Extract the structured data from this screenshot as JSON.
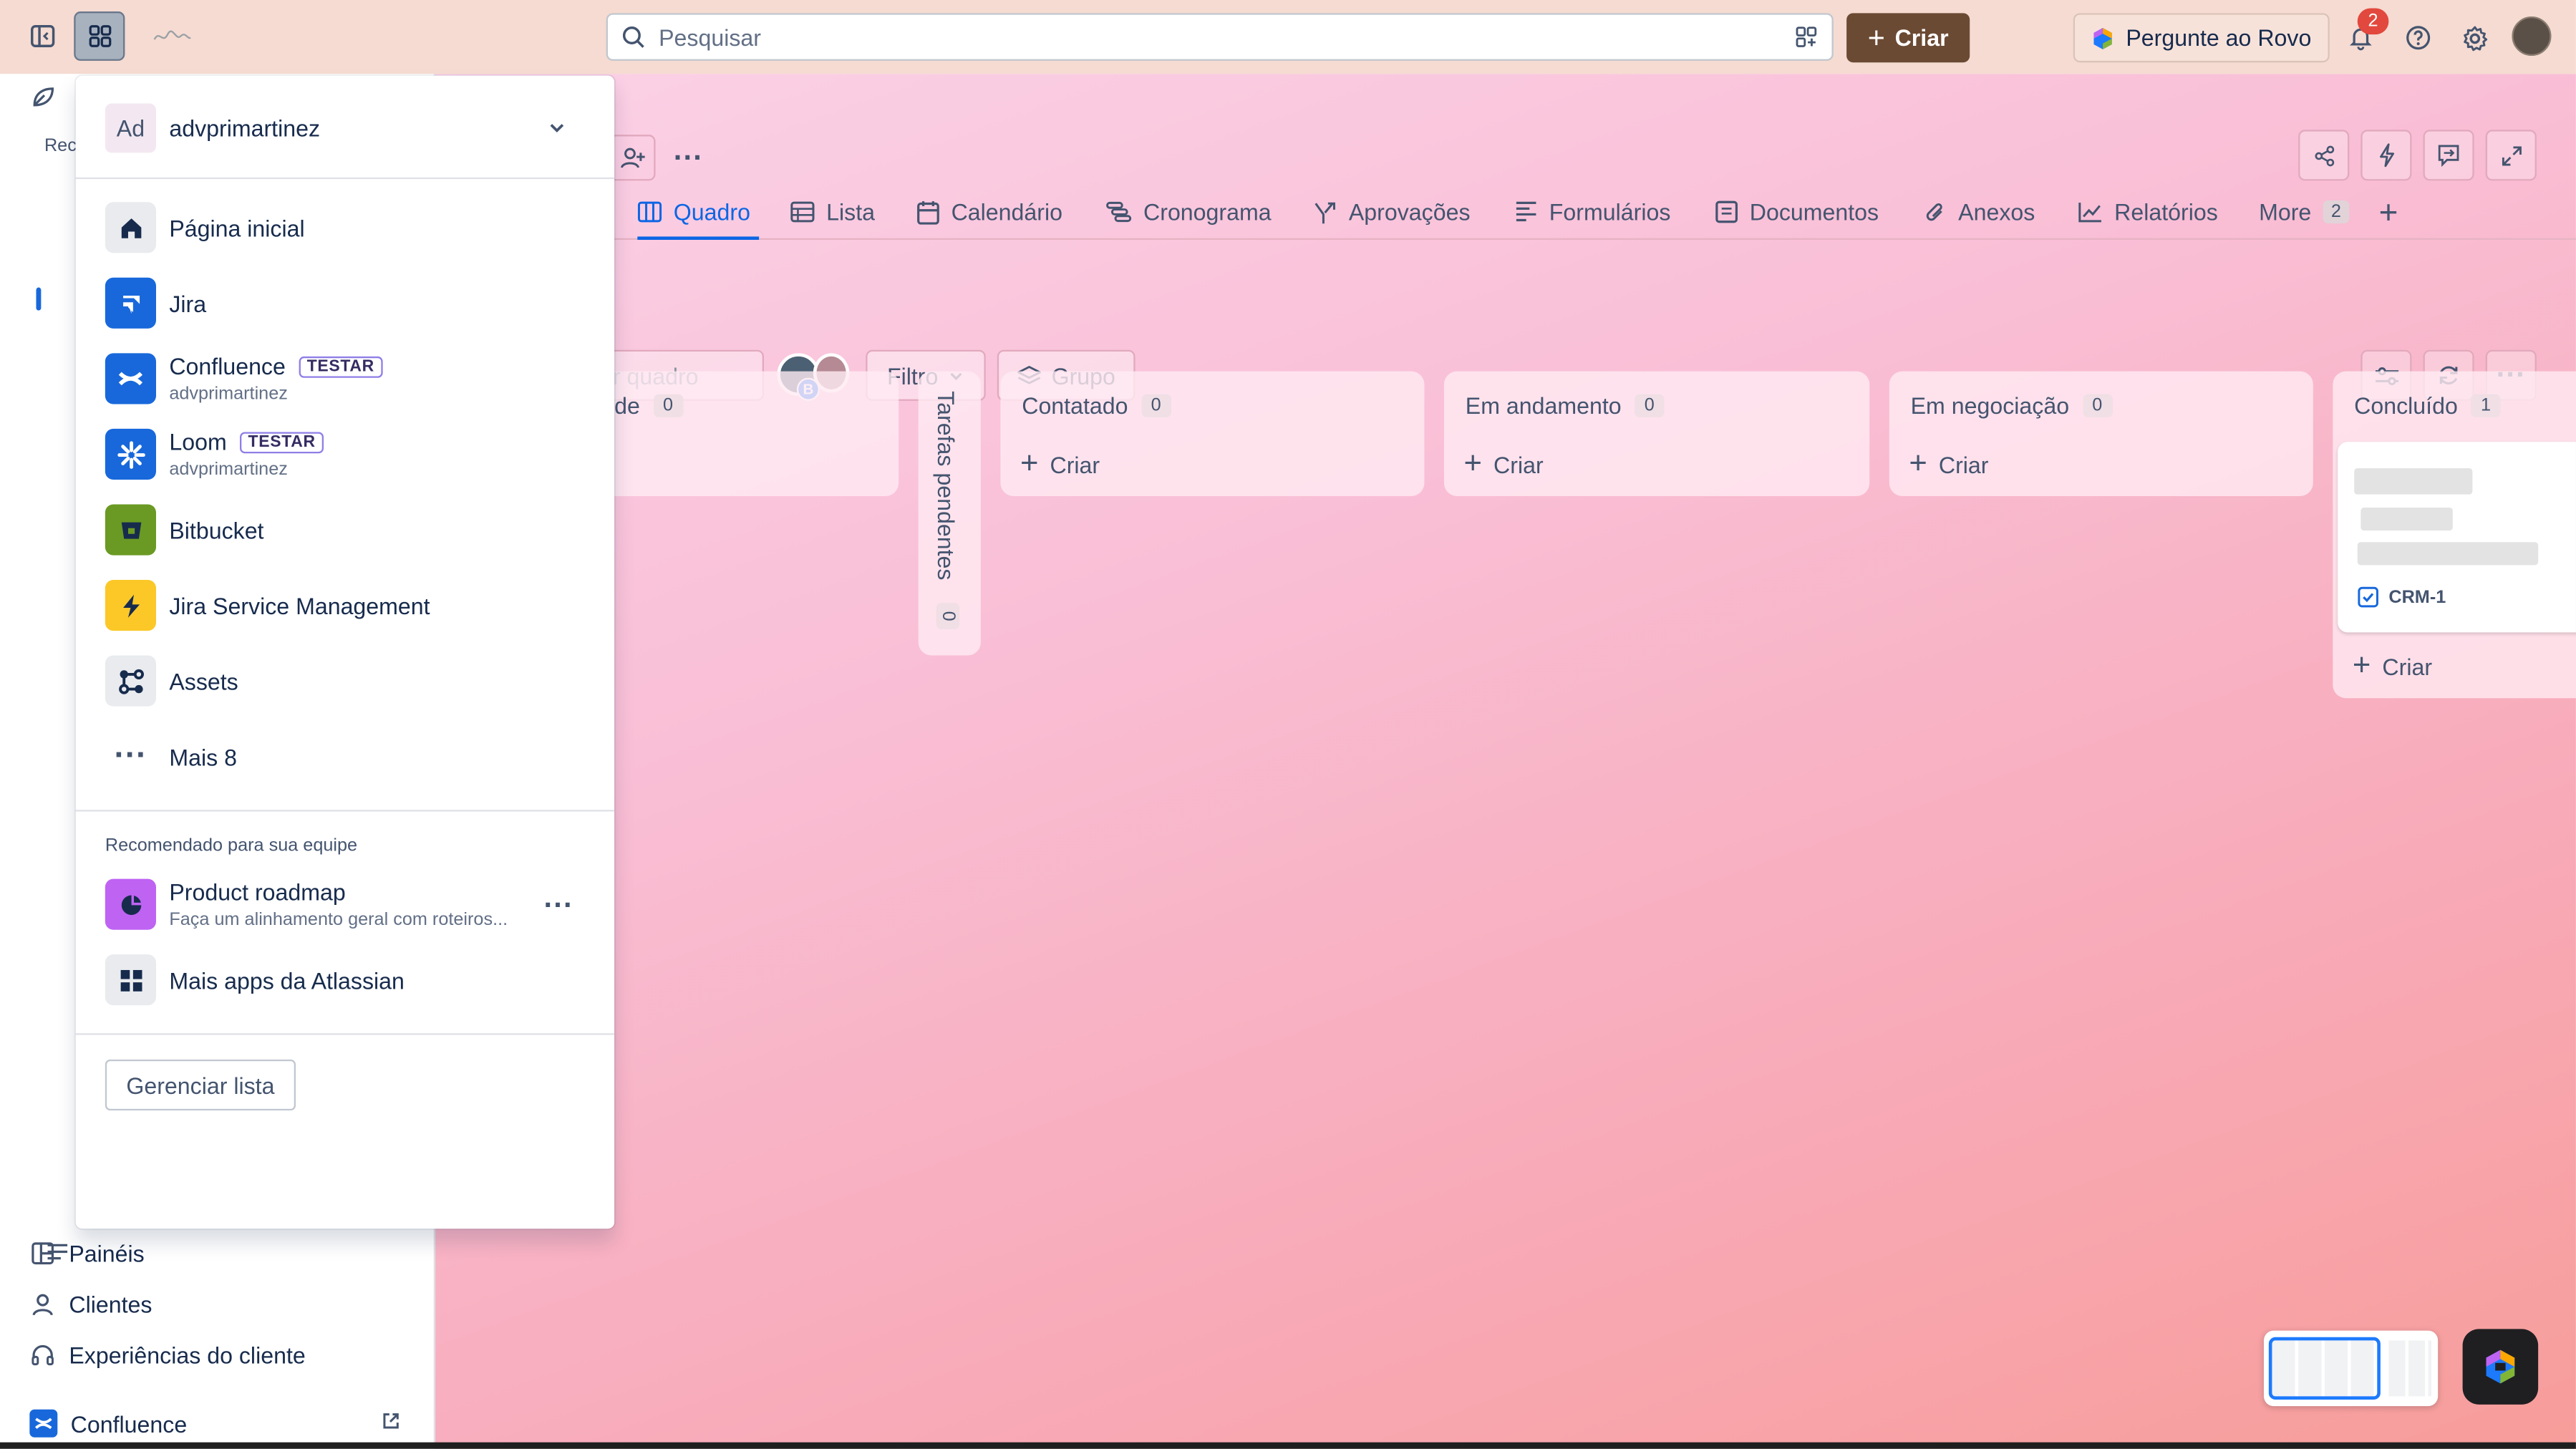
{
  "topbar": {
    "search_placeholder": "Pesquisar",
    "create_label": "Criar",
    "rovo_label": "Pergunte ao Rovo",
    "notifications_count": "2",
    "accent": "#6b4a33"
  },
  "board": {
    "tabs": [
      {
        "label": "Quadro",
        "icon": "board-icon"
      },
      {
        "label": "Lista",
        "icon": "list-icon"
      },
      {
        "label": "Calendário",
        "icon": "calendar-icon"
      },
      {
        "label": "Cronograma",
        "icon": "timeline-icon"
      },
      {
        "label": "Aprovações",
        "icon": "approvals-icon"
      },
      {
        "label": "Formulários",
        "icon": "forms-icon"
      },
      {
        "label": "Documentos",
        "icon": "document-icon"
      },
      {
        "label": "Anexos",
        "icon": "attachment-icon"
      },
      {
        "label": "Relatórios",
        "icon": "reports-icon"
      }
    ],
    "more_label": "More",
    "more_count": "2",
    "search_placeholder": "r quadro",
    "filter_label": "Filtro",
    "group_label": "Grupo",
    "columns": [
      {
        "title": "de",
        "count": "0"
      },
      {
        "title": "Contatado",
        "count": "0"
      },
      {
        "title": "Em andamento",
        "count": "0"
      },
      {
        "title": "Em negociação",
        "count": "0"
      },
      {
        "title": "Concluído",
        "count": "1"
      }
    ],
    "collapsed_column": {
      "title": "Tarefas pendentes",
      "count": "0"
    },
    "create_label": "Criar",
    "card_key": "CRM-1"
  },
  "sidebar": {
    "recent_label": "Rec",
    "items": [
      {
        "label": "Painéis",
        "icon": "dashboard-icon"
      },
      {
        "label": "Clientes",
        "icon": "person-icon"
      },
      {
        "label": "Experiências do cliente",
        "icon": "headset-icon"
      },
      {
        "label": "Confluence",
        "icon": "confluence-icon"
      }
    ]
  },
  "switcher": {
    "workspace_initials": "Ad",
    "workspace_name": "advprimartinez",
    "apps": [
      {
        "name": "Página inicial",
        "color": "#e9ebee"
      },
      {
        "name": "Jira",
        "color": "#1868db"
      },
      {
        "name": "Confluence",
        "lozenge": "TESTAR",
        "sub": "advprimartinez",
        "color": "#1868db"
      },
      {
        "name": "Loom",
        "lozenge": "TESTAR",
        "sub": "advprimartinez",
        "color": "#1868db"
      },
      {
        "name": "Bitbucket",
        "color": "#6a9a23"
      },
      {
        "name": "Jira Service Management",
        "color": "#fbc828"
      },
      {
        "name": "Assets",
        "color": "#e9ebee"
      },
      {
        "name": "Mais 8"
      }
    ],
    "recommended_label": "Recomendado para sua equipe",
    "recommended": [
      {
        "name": "Product roadmap",
        "sub": "Faça um alinhamento geral com roteiros...",
        "color": "#bf63f3"
      },
      {
        "name": "Mais apps da Atlassian"
      }
    ],
    "manage_label": "Gerenciar lista"
  }
}
